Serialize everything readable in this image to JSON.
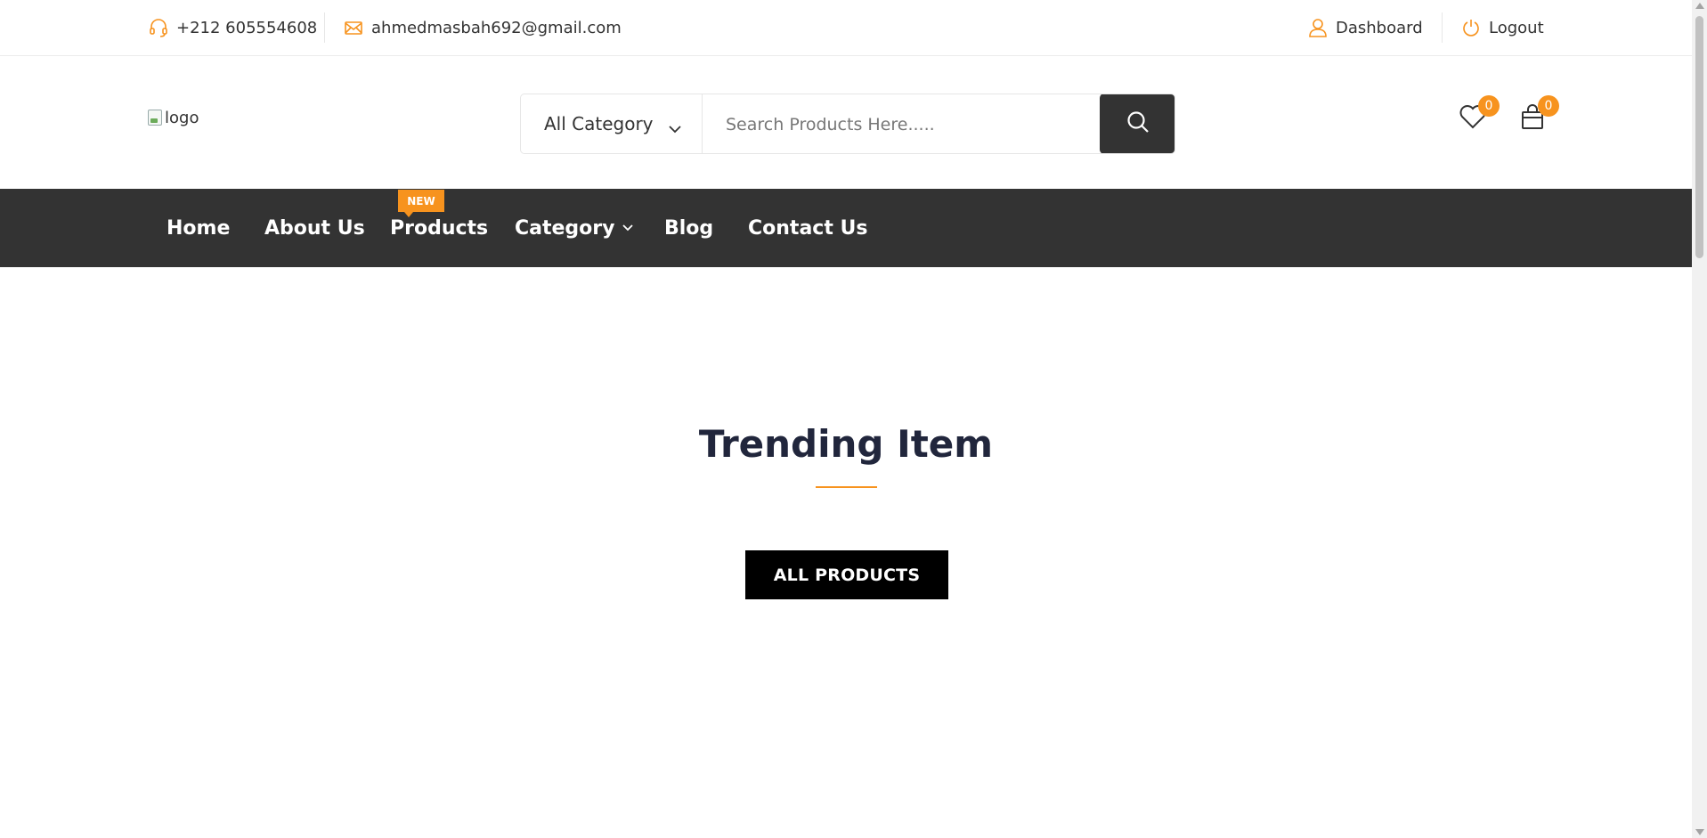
{
  "colors": {
    "accent": "#f7931e",
    "nav_bg": "#333333",
    "button_bg": "#000000",
    "title": "#21263c"
  },
  "topbar": {
    "phone": {
      "icon": "headset-icon",
      "text": "+212 605554608"
    },
    "email": {
      "icon": "envelope-icon",
      "text": "ahmedmasbah692@gmail.com"
    },
    "dashboard": {
      "icon": "user-icon",
      "label": "Dashboard"
    },
    "logout": {
      "icon": "power-icon",
      "label": "Logout"
    }
  },
  "header": {
    "logo_alt": "logo",
    "category_select": {
      "value": "All Category",
      "icon": "chevron-down-icon"
    },
    "search": {
      "placeholder": "Search Products Here.....",
      "icon": "search-icon"
    },
    "wishlist": {
      "icon": "heart-icon",
      "count": "0"
    },
    "cart": {
      "icon": "shopping-bag-icon",
      "count": "0"
    }
  },
  "nav": {
    "items": [
      {
        "label": "Home"
      },
      {
        "label": "About Us"
      },
      {
        "label": "Products",
        "tag": "NEW"
      },
      {
        "label": "Category",
        "icon": "chevron-down-icon"
      },
      {
        "label": "Blog"
      },
      {
        "label": "Contact Us"
      }
    ]
  },
  "main": {
    "title": "Trending Item",
    "button_label": "ALL PRODUCTS"
  }
}
